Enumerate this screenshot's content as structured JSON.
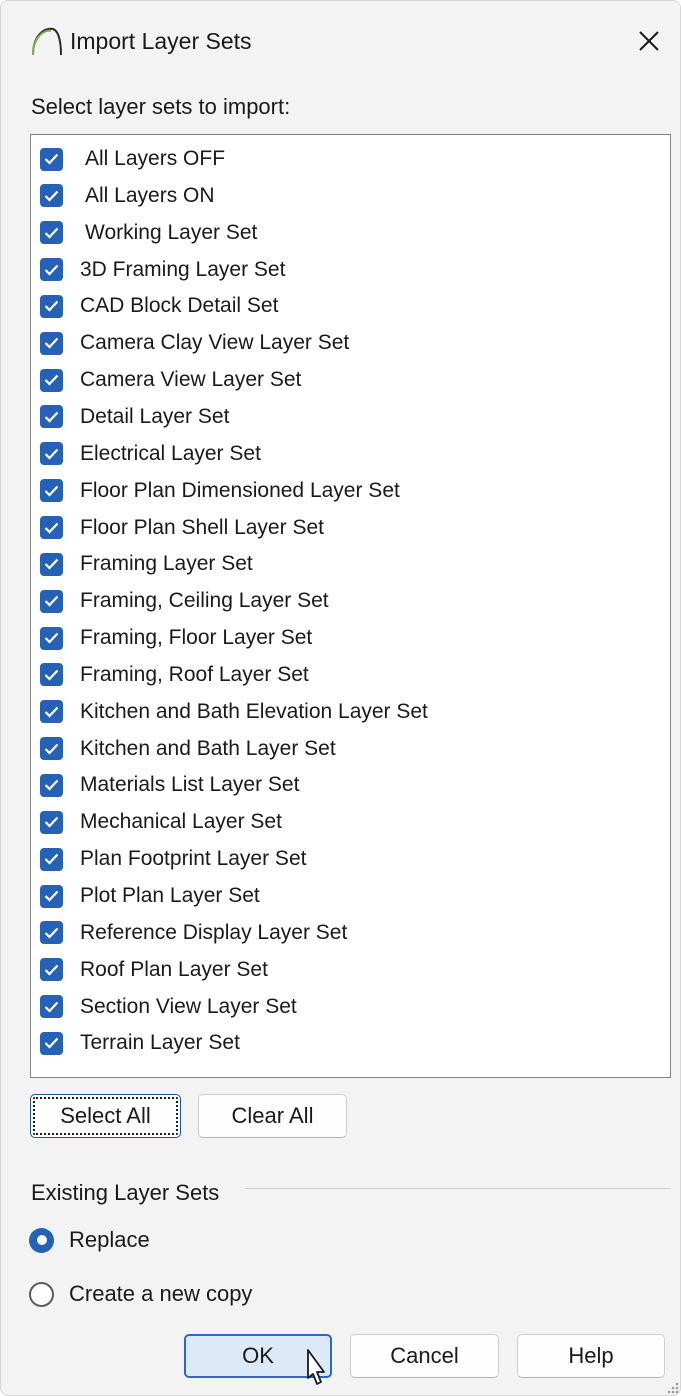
{
  "window": {
    "title": "Import Layer Sets",
    "close_label": "✕"
  },
  "prompt_label": "Select layer sets to import:",
  "layer_sets": [
    {
      "label": "All Layers OFF",
      "checked": true
    },
    {
      "label": "All Layers ON",
      "checked": true
    },
    {
      "label": "Working Layer Set",
      "checked": true
    },
    {
      "label": "3D Framing Layer Set",
      "checked": true
    },
    {
      "label": "CAD Block Detail Set",
      "checked": true
    },
    {
      "label": "Camera Clay View Layer Set",
      "checked": true
    },
    {
      "label": "Camera View Layer Set",
      "checked": true
    },
    {
      "label": "Detail Layer Set",
      "checked": true
    },
    {
      "label": "Electrical Layer Set",
      "checked": true
    },
    {
      "label": "Floor Plan Dimensioned Layer Set",
      "checked": true
    },
    {
      "label": "Floor Plan Shell Layer Set",
      "checked": true
    },
    {
      "label": "Framing Layer Set",
      "checked": true
    },
    {
      "label": "Framing, Ceiling Layer Set",
      "checked": true
    },
    {
      "label": "Framing, Floor Layer Set",
      "checked": true
    },
    {
      "label": "Framing, Roof Layer Set",
      "checked": true
    },
    {
      "label": "Kitchen and Bath Elevation Layer Set",
      "checked": true
    },
    {
      "label": "Kitchen and Bath Layer Set",
      "checked": true
    },
    {
      "label": "Materials List Layer Set",
      "checked": true
    },
    {
      "label": "Mechanical Layer Set",
      "checked": true
    },
    {
      "label": "Plan Footprint Layer Set",
      "checked": true
    },
    {
      "label": "Plot Plan Layer Set",
      "checked": true
    },
    {
      "label": "Reference Display Layer Set",
      "checked": true
    },
    {
      "label": "Roof Plan Layer Set",
      "checked": true
    },
    {
      "label": "Section View Layer Set",
      "checked": true
    },
    {
      "label": "Terrain Layer Set",
      "checked": true
    }
  ],
  "list_buttons": {
    "select_all": "Select All",
    "clear_all": "Clear All"
  },
  "existing_group": {
    "label": "Existing Layer Sets",
    "options": [
      {
        "label": "Replace",
        "selected": true
      },
      {
        "label": "Create a new copy",
        "selected": false
      }
    ]
  },
  "footer": {
    "ok": "OK",
    "cancel": "Cancel",
    "help": "Help"
  },
  "colors": {
    "accent": "#2562b5",
    "primary_button_bg": "#dbe9f8",
    "primary_button_border": "#2a67c9"
  }
}
